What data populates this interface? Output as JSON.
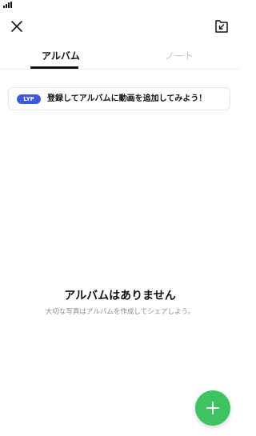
{
  "status_bar": {
    "signal_icon": "signal-bars-icon"
  },
  "header": {
    "close_icon": "close-icon",
    "save_icon": "download-folder-icon"
  },
  "tabs": [
    {
      "label": "アルバム",
      "active": true
    },
    {
      "label": "ノート",
      "active": false
    }
  ],
  "promo": {
    "badge": "LYP",
    "text": "登録してアルバムに動画を追加してみよう！"
  },
  "empty_state": {
    "title": "アルバムはありません",
    "subtitle": "大切な写真はアルバムを作成してシェアしよう。"
  },
  "fab": {
    "icon": "plus-icon",
    "color": "#3dc35f"
  },
  "colors": {
    "accent": "#3dc35f",
    "badge": "#3b5bdb",
    "inactive_tab": "#c4c4c4"
  }
}
